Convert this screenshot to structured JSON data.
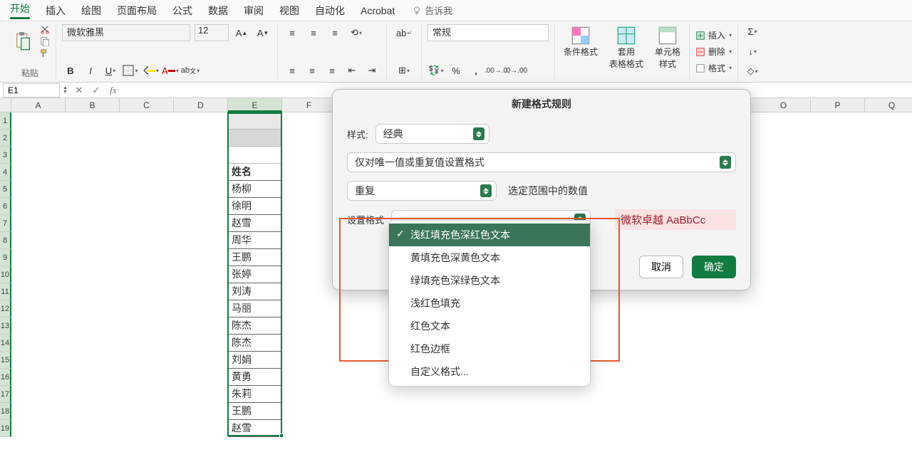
{
  "tabs": [
    "开始",
    "插入",
    "绘图",
    "页面布局",
    "公式",
    "数据",
    "审阅",
    "视图",
    "自动化",
    "Acrobat"
  ],
  "tellme": "告诉我",
  "font": {
    "name": "微软雅黑",
    "size": "12"
  },
  "clipboard_label": "粘贴",
  "number_format": "常规",
  "cf_label": "条件格式",
  "tbl_label": "套用\n表格格式",
  "cell_label": "单元格\n样式",
  "insert_label": "插入",
  "delete_label": "删除",
  "format_label": "格式",
  "namebox": "E1",
  "columns": [
    "A",
    "B",
    "C",
    "D",
    "E",
    "F",
    "",
    "",
    "",
    "",
    "",
    "",
    "",
    "O",
    "P",
    "Q"
  ],
  "col_e_data": [
    "",
    "",
    "",
    "姓名",
    "杨柳",
    "徐明",
    "赵雪",
    "周华",
    "王鹏",
    "张婷",
    "刘涛",
    "马丽",
    "陈杰",
    "陈杰",
    "刘娟",
    "黄勇",
    "朱莉",
    "王鹏",
    "赵雪"
  ],
  "dialog": {
    "title": "新建格式规则",
    "style_label": "样式:",
    "style_value": "经典",
    "rule_type": "仅对唯一值或重复值设置格式",
    "dup_value": "重复",
    "dup_text": "选定范围中的数值",
    "format_label": "设置格式",
    "preview": "微软卓越 AaBbCc",
    "cancel": "取消",
    "ok": "确定"
  },
  "dropdown": {
    "items": [
      "浅红填充色深红色文本",
      "黄填充色深黄色文本",
      "绿填充色深绿色文本",
      "浅红色填充",
      "红色文本",
      "红色边框",
      "自定义格式..."
    ]
  }
}
